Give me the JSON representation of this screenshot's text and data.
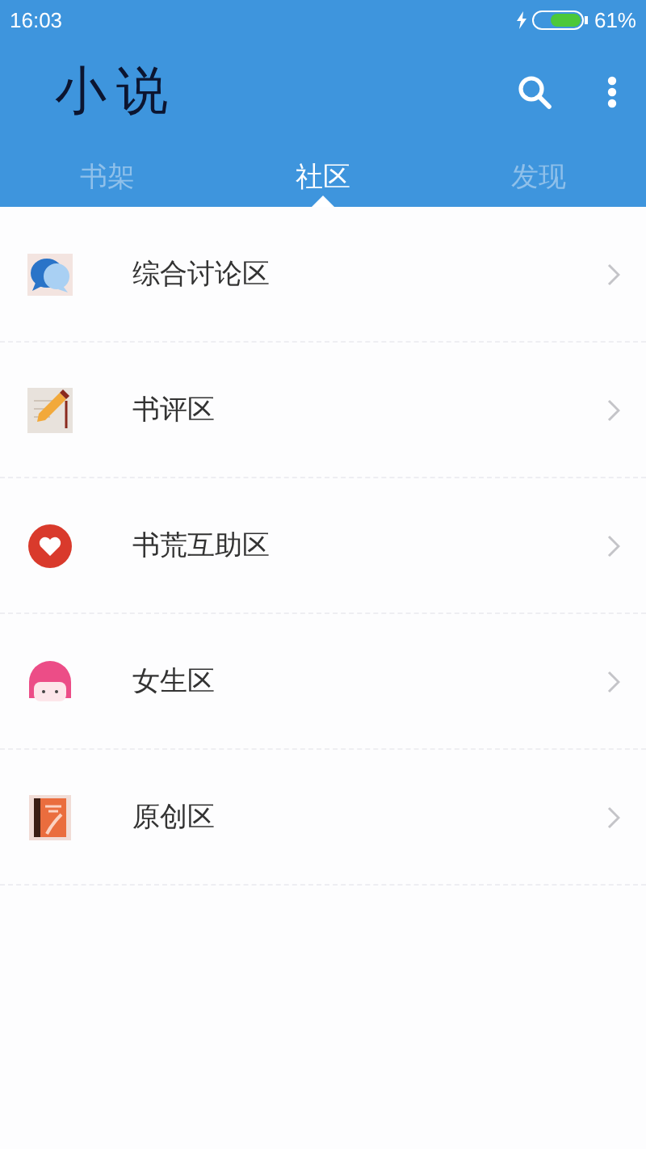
{
  "status_bar": {
    "time": "16:03",
    "battery": "61%"
  },
  "app_bar": {
    "title": "小说"
  },
  "tabs": [
    {
      "label": "书架",
      "selected": false
    },
    {
      "label": "社区",
      "selected": true
    },
    {
      "label": "发现",
      "selected": false
    }
  ],
  "sections": [
    {
      "label": "综合讨论区"
    },
    {
      "label": "书评区"
    },
    {
      "label": "书荒互助区"
    },
    {
      "label": "女生区"
    },
    {
      "label": "原创区"
    }
  ]
}
